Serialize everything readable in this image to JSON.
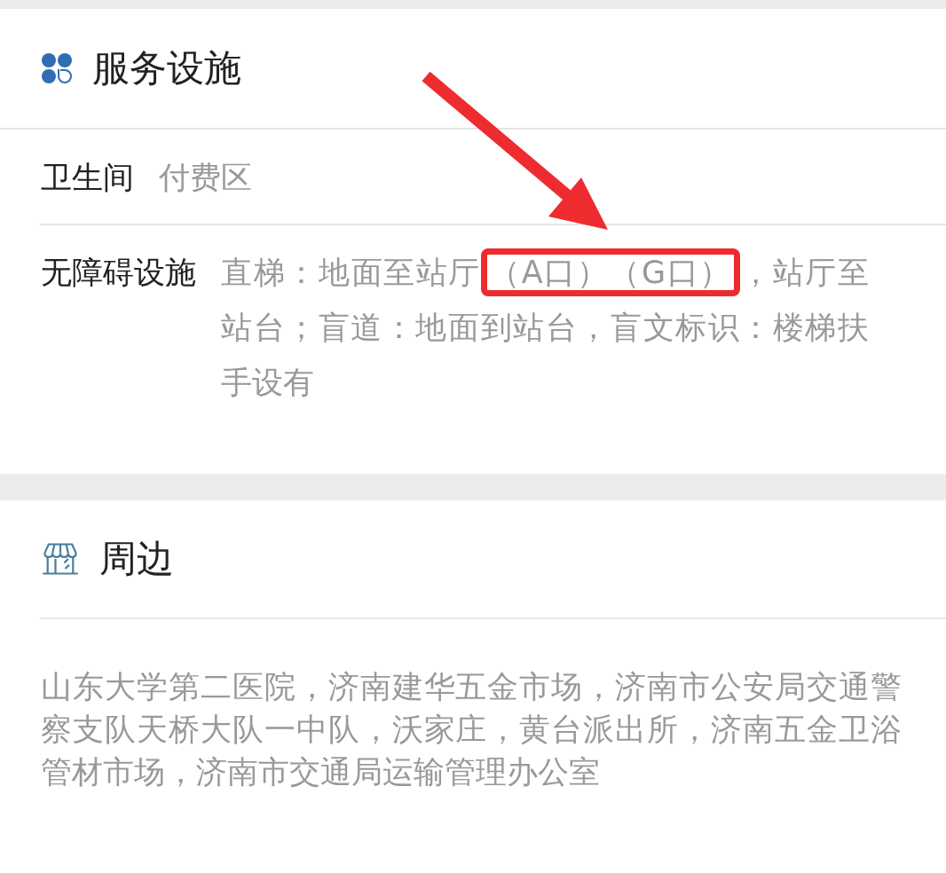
{
  "facilities": {
    "title": "服务设施",
    "rows": [
      {
        "label": "卫生间",
        "segments": [
          {
            "text": "付费区",
            "highlighted": false
          }
        ]
      },
      {
        "label": "无障碍设施",
        "segments": [
          {
            "text": "直梯：地面至站厅",
            "highlighted": false
          },
          {
            "text": "（A口）（G口）",
            "highlighted": true
          },
          {
            "text": "，站厅至站台；盲道：地面到站台，盲文标识：楼梯扶手设有",
            "highlighted": false
          }
        ]
      }
    ]
  },
  "surroundings": {
    "title": "周边",
    "text": "山东大学第二医院，济南建华五金市场，济南市公安局交通警察支队天桥大队一中队，沃家庄，黄台派出所，济南五金卫浴管材市场，济南市交通局运输管理办公室"
  }
}
